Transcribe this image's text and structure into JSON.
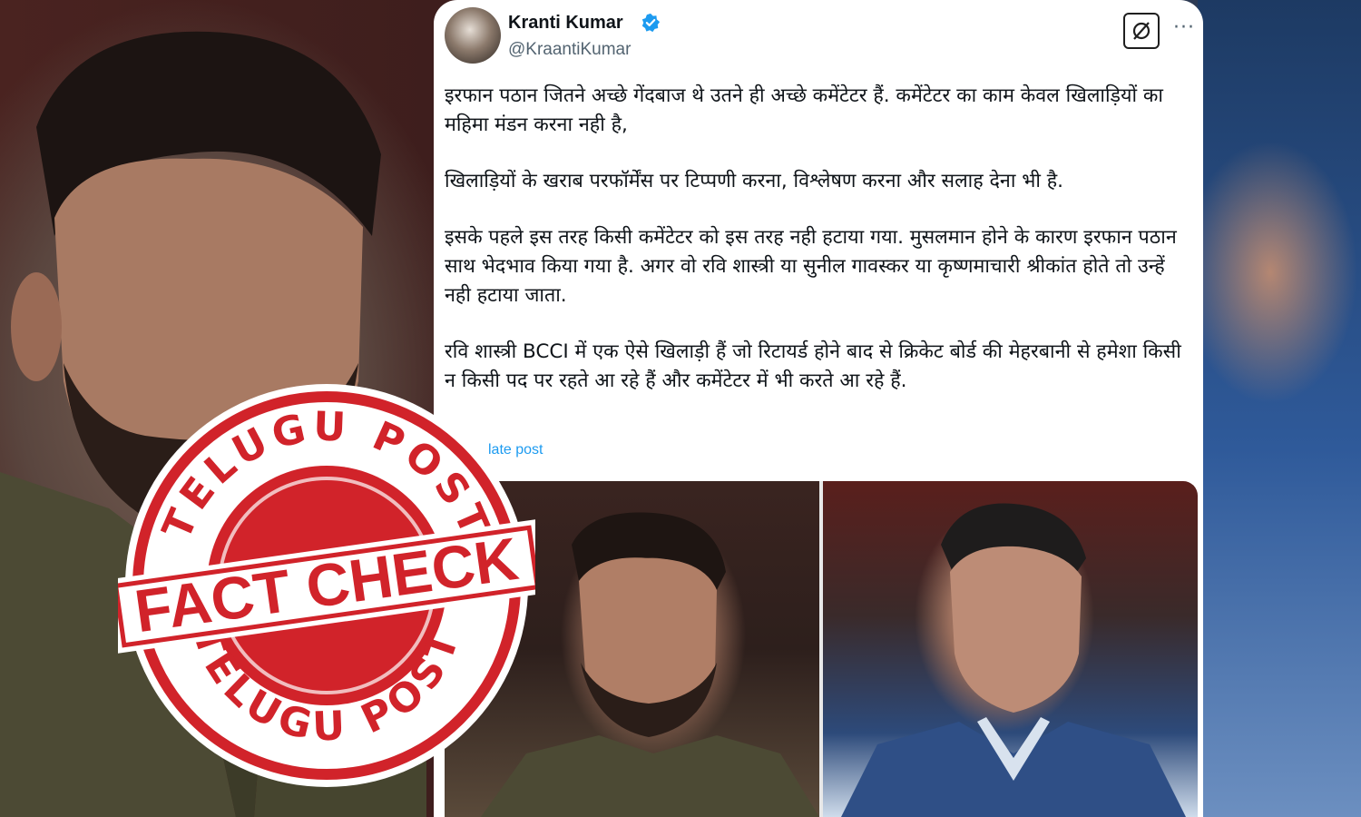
{
  "tweet": {
    "author_name": "Kranti Kumar",
    "author_handle": "@KraantiKumar",
    "verified": true,
    "paragraphs": [
      "इरफान पठान जितने अच्छे गेंदबाज थे उतने ही अच्छे कमेंटेटर हैं. कमेंटेटर का काम केवल खिलाड़ियों का महिमा मंडन करना नही है,",
      "खिलाड़ियों के खराब परफॉर्मेंस पर टिप्पणी करना, विश्लेषण करना और सलाह देना भी है.",
      "इसके पहले इस तरह किसी कमेंटेटर को इस तरह नही हटाया गया. मुसलमान होने के कारण इरफान पठान साथ भेदभाव किया गया है. अगर वो रवि शास्त्री या सुनील गावस्कर या कृष्णमाचारी श्रीकांत होते तो उन्हें नही हटाया जाता.",
      "रवि शास्त्री BCCI में एक ऐसे खिलाड़ी हैं जो रिटायर्ड होने बाद से क्रिकेट बोर्ड की मेहरबानी से हमेशा किसी न किसी पद पर रहते आ रहे हैं और कमेंटेटर में भी करते आ रहे हैं."
    ],
    "translate_link": "late post",
    "more_glyph": "···"
  },
  "stamp": {
    "top_text": "TELUGU POST",
    "center_text": "FACT CHECK",
    "bottom_text": "TELUGU POST",
    "color": "#d1232a"
  },
  "colors": {
    "card_bg": "#ffffff",
    "text": "#0f1419",
    "secondary": "#536471",
    "link": "#1d9bf0",
    "verified": "#1d9bf0"
  }
}
